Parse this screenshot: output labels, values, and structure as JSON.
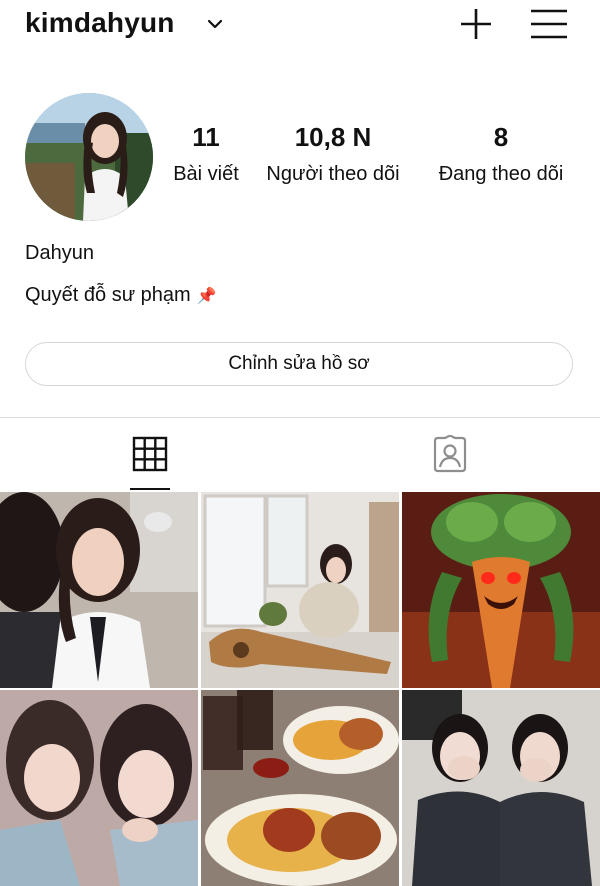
{
  "header": {
    "username": "kimdahyun",
    "chevron_icon": "chevron-down-icon",
    "add_icon": "plus-icon",
    "menu_icon": "hamburger-menu-icon"
  },
  "profile": {
    "stats": {
      "posts": {
        "value": "11",
        "label": "Bài viết"
      },
      "followers": {
        "value": "10,8 N",
        "label": "Người theo dõi"
      },
      "following": {
        "value": "8",
        "label": "Đang theo dõi"
      }
    },
    "display_name": "Dahyun",
    "bio": "Quyết đỗ sư phạm",
    "bio_emoji": "pushpin-icon",
    "edit_button_label": "Chỉnh sửa hồ sơ"
  },
  "tabs": [
    {
      "name": "posts-grid",
      "icon": "grid-icon",
      "active": true
    },
    {
      "name": "tagged",
      "icon": "tagged-person-icon",
      "active": false
    }
  ],
  "posts": [
    {
      "description": "two girls in school uniform"
    },
    {
      "description": "girl sitting by window with guitar"
    },
    {
      "description": "monstrous vegetable creature artwork"
    },
    {
      "description": "close-up of two girls"
    },
    {
      "description": "spaghetti with fried chicken and drinks"
    },
    {
      "description": "two girls in dark uniforms covering faces"
    }
  ]
}
